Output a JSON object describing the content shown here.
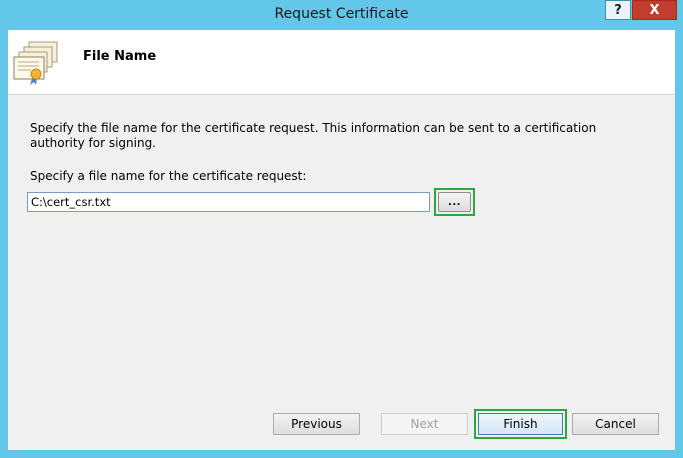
{
  "window": {
    "title": "Request Certificate",
    "help_label": "?",
    "close_label": "X"
  },
  "header": {
    "title": "File Name",
    "icon": "certificate-icon"
  },
  "content": {
    "description": "Specify the file name for the certificate request. This information can be sent to a certification authority for signing.",
    "field_label": "Specify a file name for the certificate request:",
    "file_value": "C:\\cert_csr.txt",
    "browse_label": "..."
  },
  "footer": {
    "previous_label": "Previous",
    "next_label": "Next",
    "finish_label": "Finish",
    "cancel_label": "Cancel"
  },
  "colors": {
    "titlebar": "#63c7ea",
    "close": "#c43c2e",
    "highlight": "#27a93b"
  }
}
